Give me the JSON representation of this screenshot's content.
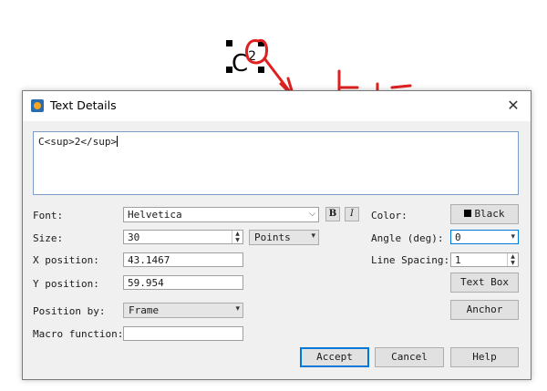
{
  "canvas": {
    "text_base": "C",
    "text_sup": "2"
  },
  "annotation": {
    "text": "上标",
    "color": "#e02020"
  },
  "dialog": {
    "title": "Text Details",
    "close_glyph": "✕",
    "content": "C<sup>2</sup>",
    "font_label": "Font:",
    "font_value": "Helvetica",
    "bold_label": "B",
    "italic_label": "I",
    "color_label": "Color:",
    "color_value": "Black",
    "size_label": "Size:",
    "size_value": "30",
    "size_unit": "Points",
    "angle_label": "Angle (deg):",
    "angle_value": "0",
    "xpos_label": "X position:",
    "xpos_value": "43.1467",
    "line_spacing_label": "Line Spacing:",
    "line_spacing_value": "1",
    "ypos_label": "Y position:",
    "ypos_value": "59.954",
    "textbox_label": "Text Box",
    "position_by_label": "Position by:",
    "position_by_value": "Frame",
    "anchor_label": "Anchor",
    "macro_label": "Macro function:",
    "macro_value": "",
    "accept_label": "Accept",
    "cancel_label": "Cancel",
    "help_label": "Help"
  }
}
